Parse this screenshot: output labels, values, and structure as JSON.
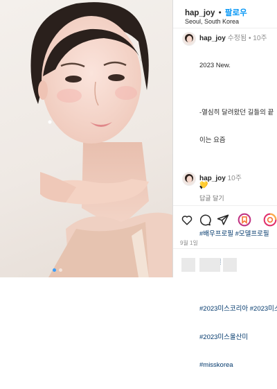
{
  "header": {
    "username": "hap_joy",
    "separator": "•",
    "follow_label": "팔로우",
    "location": "Seoul, South Korea"
  },
  "caption": {
    "username": "hap_joy",
    "edited": "수정됨",
    "separator": "•",
    "age": "10주",
    "lines": [
      "2023 New.",
      "",
      "-열심히 달려왔던 길들의 끝",
      "이는 요즘",
      "",
      "♥",
      "",
      "#배우프로필 #모델프로필",
      "#프로필",
      "",
      "#2023미스코리아 #2023미스",
      "#2023미스울산미",
      "#misskorea"
    ]
  },
  "comment": {
    "username": "hap_joy",
    "age": "10주",
    "emoji": "💛",
    "reply_label": "답글 달기"
  },
  "actions": [
    "heart-icon",
    "comment-icon",
    "share-icon",
    "save-icon",
    "emoji-icon"
  ],
  "date": "9월 1일",
  "colors": {
    "accent": "#0095f6",
    "hashtag": "#00376b",
    "muted": "#8e8e8e"
  }
}
